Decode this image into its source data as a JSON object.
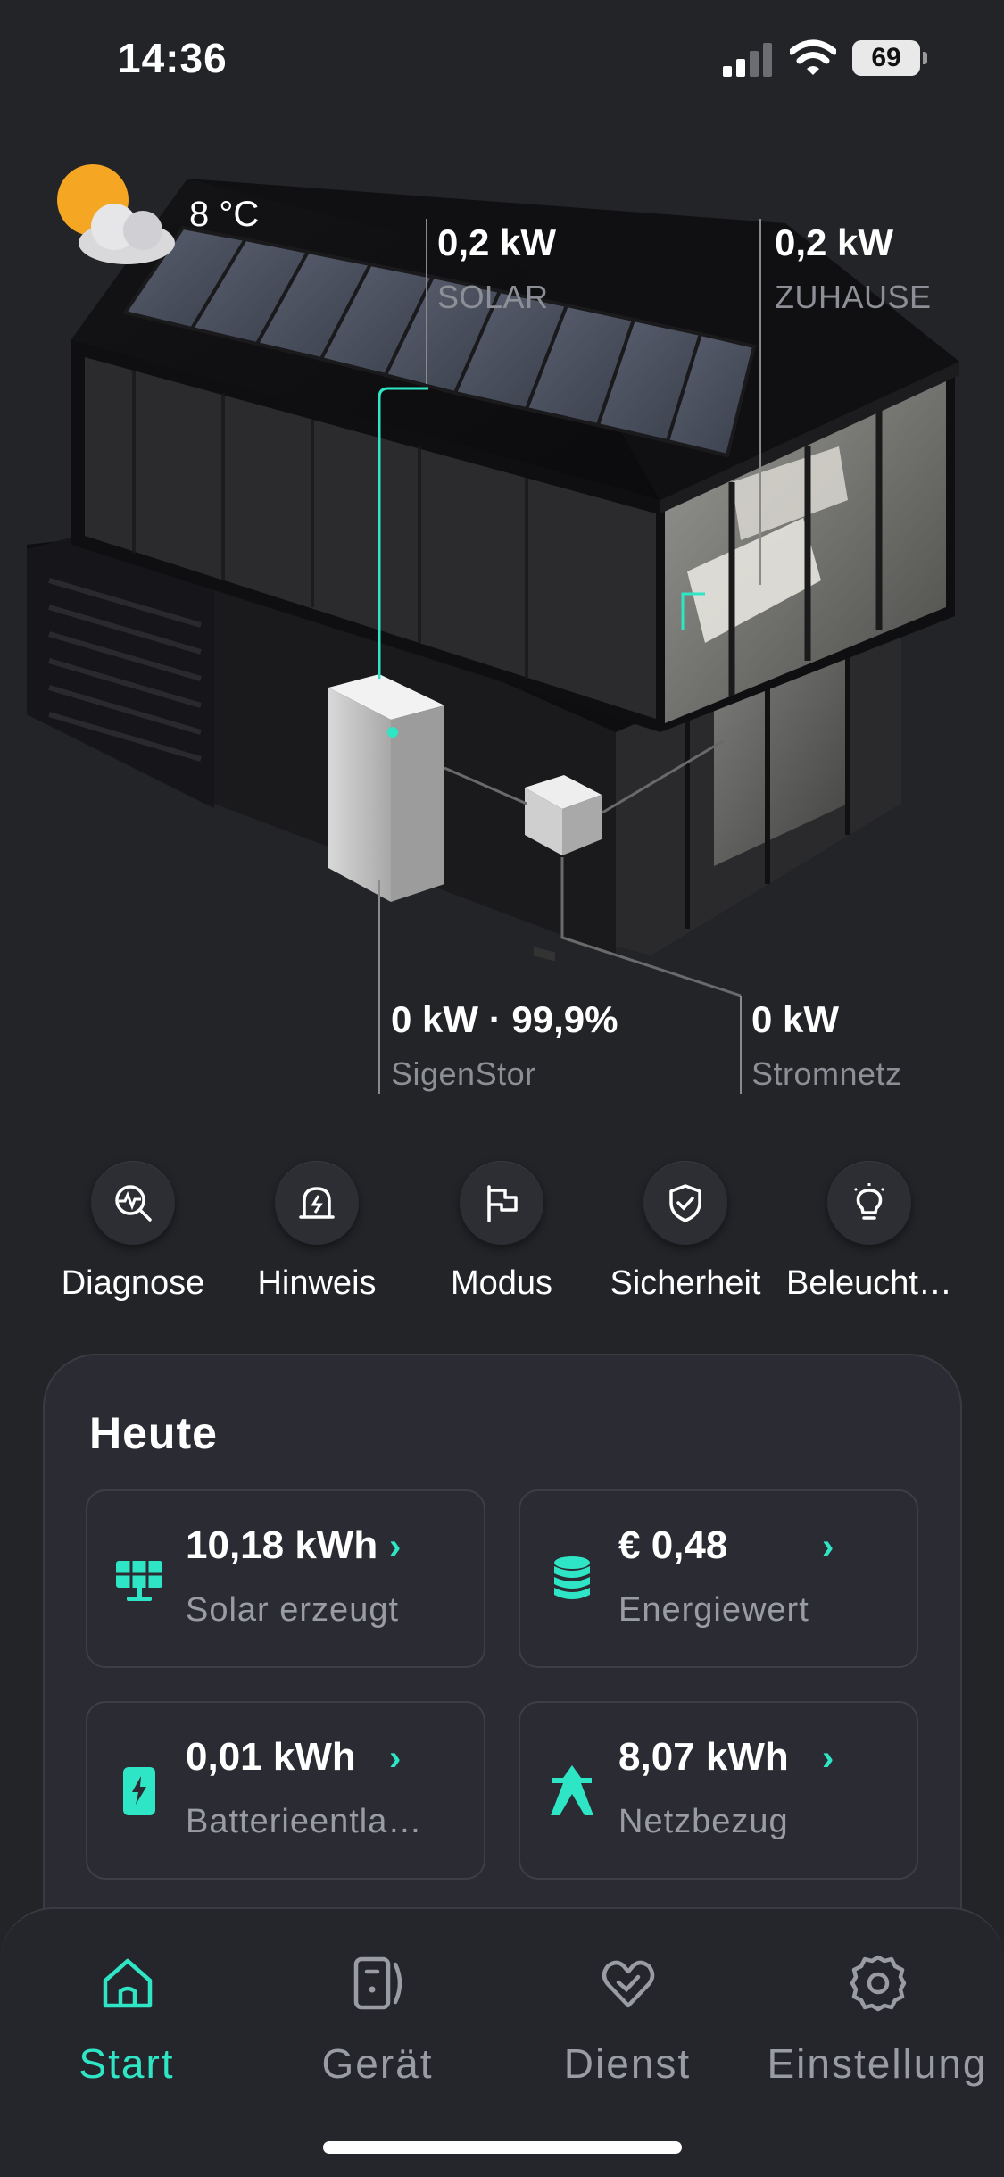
{
  "status_bar": {
    "time": "14:36",
    "battery": "69"
  },
  "weather": {
    "temperature": "8 °C",
    "icon": "partly-cloudy-icon"
  },
  "flows": {
    "solar": {
      "value": "0,2 kW",
      "label": "SOLAR"
    },
    "home": {
      "value": "0,2 kW",
      "label": "ZUHAUSE"
    },
    "storage": {
      "value": "0 kW · 99,9%",
      "label": "SigenStor"
    },
    "grid": {
      "value": "0 kW",
      "label": "Stromnetz"
    }
  },
  "quick_actions": [
    {
      "label": "Diagnose",
      "icon": "diagnose-icon"
    },
    {
      "label": "Hinweis",
      "icon": "alert-icon"
    },
    {
      "label": "Modus",
      "icon": "flag-icon"
    },
    {
      "label": "Sicherheit",
      "icon": "shield-check-icon"
    },
    {
      "label": "Beleucht…",
      "icon": "lightbulb-icon"
    }
  ],
  "today": {
    "title": "Heute",
    "tiles": [
      {
        "value": "10,18 kWh",
        "label": "Solar erzeugt",
        "icon": "solar-panel-icon"
      },
      {
        "value": "€ 0,48",
        "label": "Energiewert",
        "icon": "coin-stack-icon"
      },
      {
        "value": "0,01 kWh",
        "label": "Batterieentla…",
        "icon": "battery-discharge-icon"
      },
      {
        "value": "8,07 kWh",
        "label": "Netzbezug",
        "icon": "grid-tower-icon"
      }
    ]
  },
  "tabs": [
    {
      "label": "Start",
      "icon": "home-icon",
      "active": true
    },
    {
      "label": "Gerät",
      "icon": "device-icon",
      "active": false
    },
    {
      "label": "Dienst",
      "icon": "service-heart-icon",
      "active": false
    },
    {
      "label": "Einstellung",
      "icon": "gear-icon",
      "active": false
    }
  ],
  "colors": {
    "accent": "#2ee6c5",
    "background": "#232428",
    "card": "#2b2c33"
  }
}
